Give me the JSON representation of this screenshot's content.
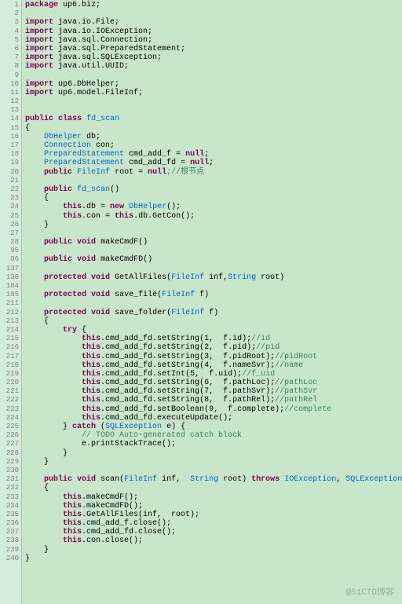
{
  "pkg": "package",
  "imp": "import",
  "pub": "public",
  "cls": "class",
  "prot": "protected",
  "vo": "void",
  "nw": "new",
  "tr": "try",
  "ca": "catch",
  "thr": "throws",
  "ret": "null",
  "pkgname": " up6.biz;",
  "imp1": " java.io.File;",
  "imp2": " java.io.IOException;",
  "imp3": " java.sql.Connection;",
  "imp4": " java.sql.PreparedStatement;",
  "imp5": " java.sql.SQLException;",
  "imp6": " java.util.UUID;",
  "imp7": " up6.DbHelper;",
  "imp8": " up6.model.FileInf;",
  "clsname": "fd_scan",
  "f1t": "DbHelper",
  "f1n": " db;",
  "f2t": "Connection",
  "f2n": " con;",
  "f3t": "PreparedStatement",
  "f3n": " cmd_add_f = ",
  "f4t": "PreparedStatement",
  "f4n": " cmd_add_fd = ",
  "f5t": "FileInf",
  "f5n": " root = ",
  "f5c": ";//根节点",
  "ctor": "fd_scan",
  "ctor1": ".db = ",
  "ctor1b": "DbHelper",
  "ctor1c": "();",
  "ctor2": ".con = ",
  "this": "this",
  "ctor2b": ".db.GetCon();",
  "m1": "makeCmdF",
  "m2": "makeCmdFD",
  "m3": "GetAllFiles",
  "m3p": "(FileInf inf,String root)",
  "m4": "save_file",
  "m4p": "(FileInf f)",
  "m5": "save_folder",
  "m5p": "(FileInf f)",
  "m6": "scan",
  "m6p": "(FileInf inf,  String root)",
  "Str": "String",
  "FI": "FileInf",
  "IOE": "IOException",
  "SQLE": "SQLException",
  "cmd": ".cmd_add_fd.",
  "ss": "setString",
  "si": "setInt",
  "sb": "setBoolean",
  "eu": "executeUpdate",
  "l1": "(1,  f.id);",
  "l1c": "//id",
  "l2": "(2,  f.pid);",
  "l2c": "//pid",
  "l3": "(3,  f.pidRoot);",
  "l3c": "//pidRoot",
  "l4": "(4,  f.nameSvr);",
  "l4c": "//name",
  "l5": "(5,  f.uid);",
  "l5c": "//f_uid",
  "l6": "(6,  f.pathLoc);",
  "l6c": "//pathLoc",
  "l7": "(7,  f.pathSvr);",
  "l7c": "//pathSvr",
  "l8": "(8,  f.pathRel);",
  "l8c": "//pathRel",
  "l9": "(9,  f.complete);",
  "l9c": "//complete",
  "l10": "();",
  "exv": "SQLException",
  "exn": " e) {",
  "todo": "// TODO Auto-generated catch block",
  "pst": "e.printStackTrace();",
  "sc1": ".makeCmdF();",
  "sc2": ".makeCmdFD();",
  "sc3": ".GetAllFiles(inf,  root);",
  "sc4": ".cmd_add_f.close();",
  "sc5": ".cmd_add_fd.close();",
  "sc6": ".con.close();",
  "wm": "@51CTO博客"
}
